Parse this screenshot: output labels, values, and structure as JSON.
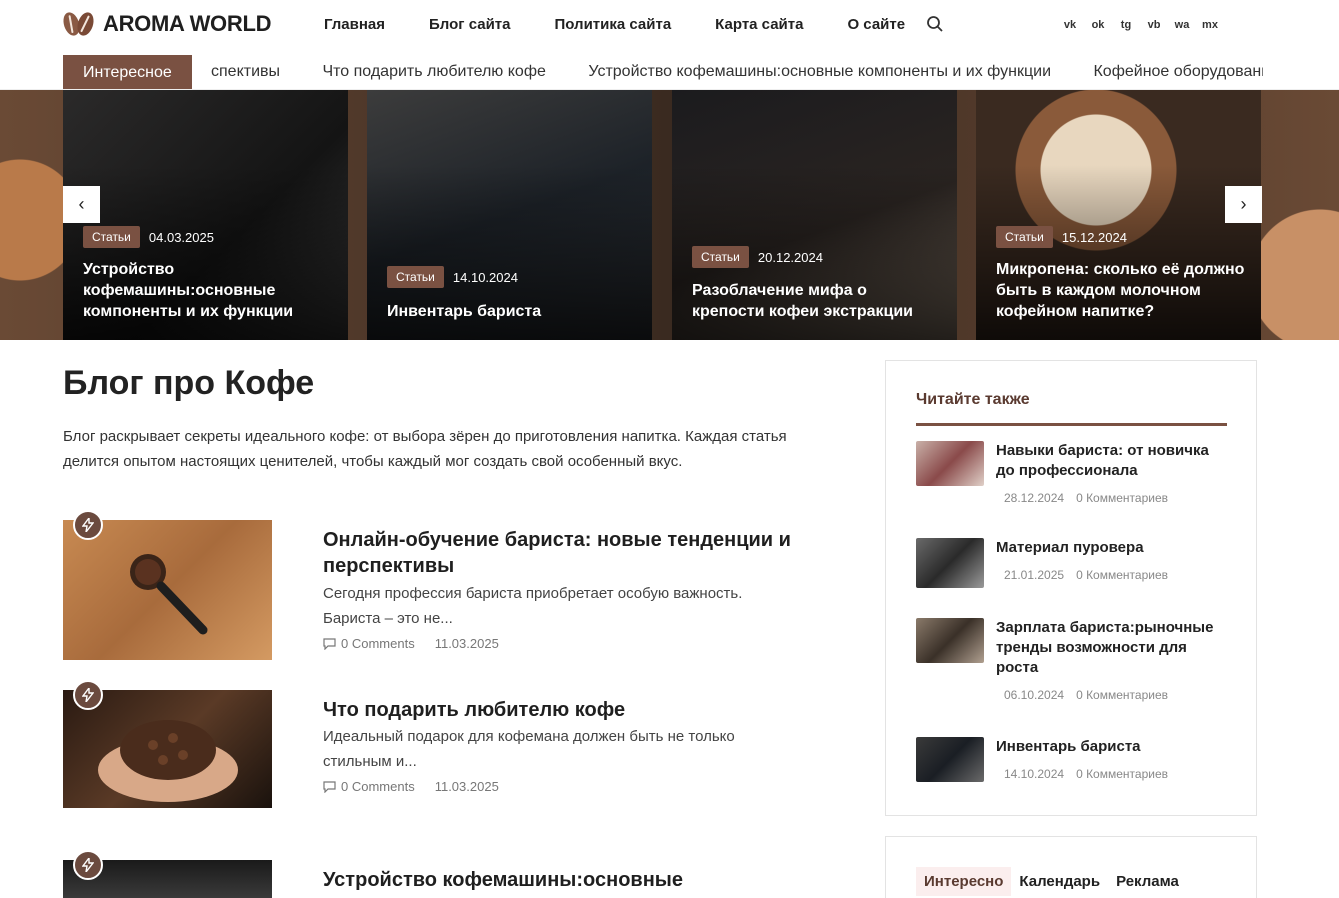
{
  "header": {
    "logo_text": "AROMA WORLD",
    "nav": [
      "Главная",
      "Блог сайта",
      "Политика сайта",
      "Карта сайта",
      "О сайте"
    ],
    "social_icons": [
      "vk-icon",
      "ok-icon",
      "telegram-icon",
      "viber-icon",
      "whatsapp-icon",
      "max-icon"
    ],
    "social_labels": [
      "vk",
      "ok",
      "tg",
      "vb",
      "wa",
      "mx"
    ]
  },
  "ticker": {
    "label": "Интересное",
    "items": [
      "спективы",
      "Что подарить любителю кофе",
      "Устройство кофемашины:основные компоненты и их функции",
      "Кофейное оборудование"
    ]
  },
  "slider": {
    "slides": [
      {
        "badge": "Статьи",
        "date": "04.03.2025",
        "title": "Устройство кофемашины:основные компоненты и их функции"
      },
      {
        "badge": "Статьи",
        "date": "14.10.2024",
        "title": "Инвентарь бариста"
      },
      {
        "badge": "Статьи",
        "date": "20.12.2024",
        "title": "Разоблачение мифа о крепости кофеи экстракции"
      },
      {
        "badge": "Статьи",
        "date": "15.12.2024",
        "title": "Микропена: сколько её должно быть в каждом молочном кофейном напитке?"
      }
    ],
    "prev": "‹",
    "next": "›"
  },
  "main": {
    "title": "Блог про Кофе",
    "description": "Блог раскрывает секреты идеального кофе: от выбора зёрен до приготовления напитка. Каждая статья делится опытом настоящих ценителей, чтобы каждый мог создать свой особенный вкус.",
    "posts": [
      {
        "title": "Онлайн-обучение бариста: новые тенденции и перспективы",
        "excerpt": "Сегодня профессия бариста приобретает особую важность. Бариста – это не...",
        "comments": "0 Comments",
        "date": "11.03.2025"
      },
      {
        "title": "Что подарить любителю кофе",
        "excerpt": "Идеальный подарок для кофемана должен быть не только стильным и...",
        "comments": "0 Comments",
        "date": "11.03.2025"
      },
      {
        "title": "Устройство кофемашины:основные",
        "excerpt": "",
        "comments": "",
        "date": ""
      }
    ]
  },
  "sidebar": {
    "read_also_title": "Читайте также",
    "items": [
      {
        "title": "Навыки бариста: от новичка до профессионала",
        "date": "28.12.2024",
        "comments": "0 Комментариев"
      },
      {
        "title": "Материал пуровера",
        "date": "21.01.2025",
        "comments": "0 Комментариев"
      },
      {
        "title": "Зарплата бариста:рыночные тренды возможности для роста",
        "date": "06.10.2024",
        "comments": "0 Комментариев"
      },
      {
        "title": "Инвентарь бариста",
        "date": "14.10.2024",
        "comments": "0 Комментариев"
      }
    ],
    "tabs": [
      "Интересно",
      "Календарь",
      "Реклама"
    ]
  },
  "colors": {
    "accent": "#7a5142",
    "text": "#222222"
  }
}
